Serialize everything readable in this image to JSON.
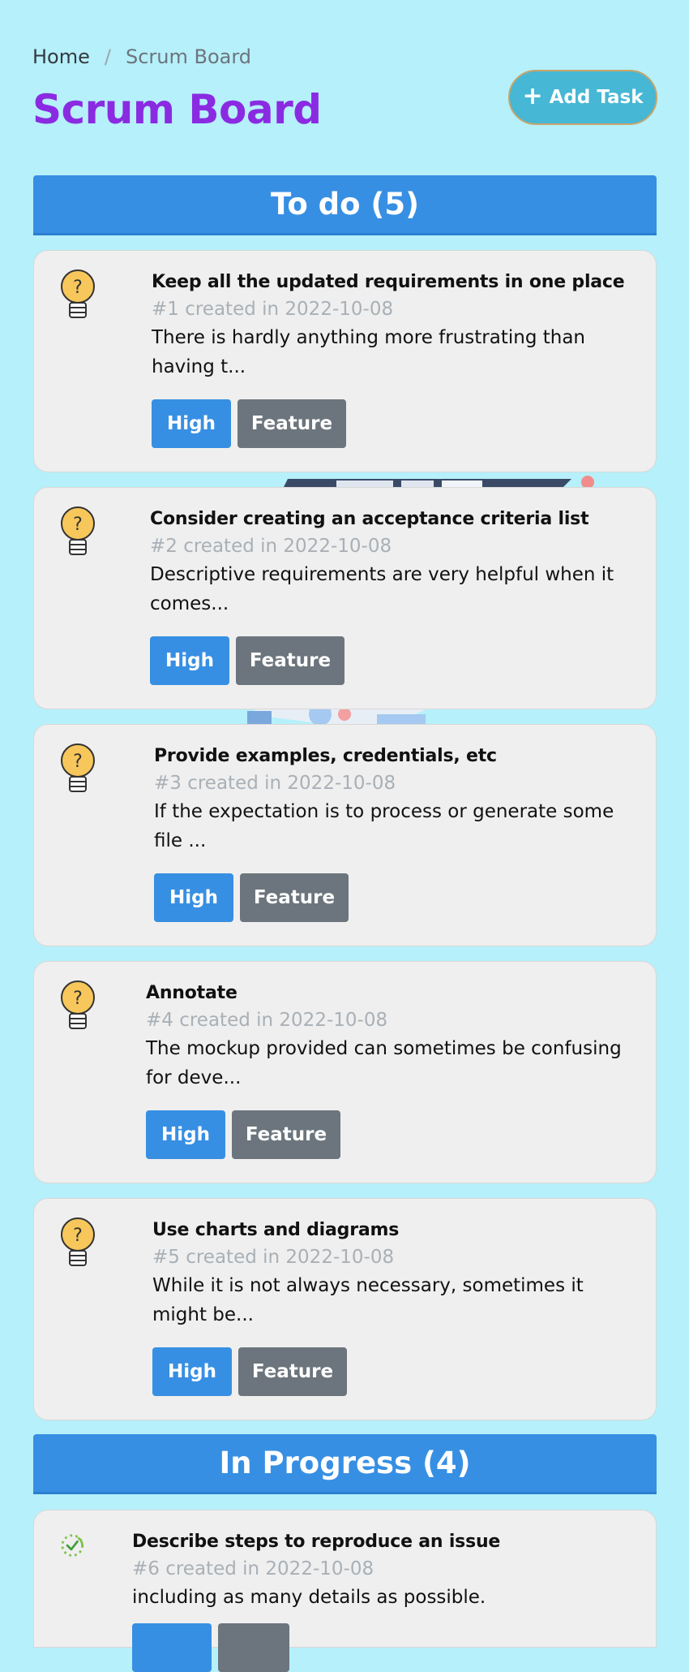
{
  "breadcrumb": {
    "home": "Home",
    "separator": "/",
    "current": "Scrum Board"
  },
  "page": {
    "title": "Scrum Board"
  },
  "actions": {
    "add_task_label": "Add Task",
    "add_task_icon": "plus-icon"
  },
  "columns": [
    {
      "title": "To do (5)",
      "cards": [
        {
          "icon": "lightbulb-question-icon",
          "title": "Keep all the updated requirements in one place",
          "meta": "#1 created in 2022-10-08",
          "desc": "There is hardly anything more frustrating than having t...",
          "priority": "High",
          "type": "Feature"
        },
        {
          "icon": "lightbulb-question-icon",
          "title": "Consider creating an acceptance criteria list",
          "meta": "#2 created in 2022-10-08",
          "desc": "Descriptive requirements are very helpful when it comes...",
          "priority": "High",
          "type": "Feature"
        },
        {
          "icon": "lightbulb-question-icon",
          "title": "Provide examples, credentials, etc",
          "meta": "#3 created in 2022-10-08",
          "desc": "If the expectation is to process or generate some file ...",
          "priority": "High",
          "type": "Feature"
        },
        {
          "icon": "lightbulb-question-icon",
          "title": "Annotate",
          "meta": "#4 created in 2022-10-08",
          "desc": "The mockup provided can sometimes be confusing for deve...",
          "priority": "High",
          "type": "Feature"
        },
        {
          "icon": "lightbulb-question-icon",
          "title": "Use charts and diagrams",
          "meta": "#5 created in 2022-10-08",
          "desc": "While it is not always necessary, sometimes it might be...",
          "priority": "High",
          "type": "Feature"
        }
      ]
    },
    {
      "title": "In Progress (4)",
      "cards": [
        {
          "icon": "progress-check-icon",
          "title": "Describe steps to reproduce an issue",
          "meta": "#6 created in 2022-10-08",
          "desc": "including as many details as possible."
        }
      ]
    }
  ],
  "colors": {
    "background": "#b6f0fa",
    "accent": "#378fe3",
    "title": "#8a2be2",
    "tag_secondary": "#6c757d",
    "add_button": "#46b7d4"
  }
}
